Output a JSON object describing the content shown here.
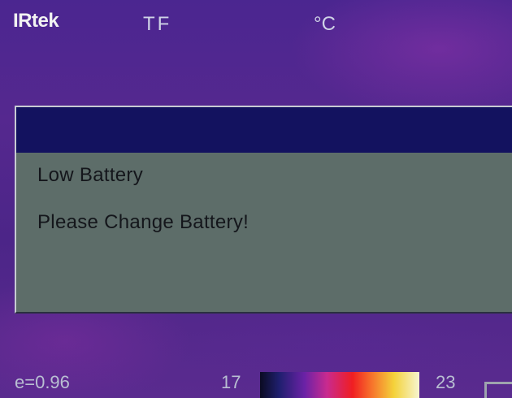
{
  "header": {
    "brand": "IRtek",
    "mode": "TF",
    "unit": "°C"
  },
  "dialog": {
    "title": "",
    "line1": "Low Battery",
    "line2": "Please Change Battery!"
  },
  "status": {
    "emissivity": "e=0.96",
    "temp_min": "17",
    "temp_max": "23"
  },
  "colors": {
    "background": "#4a2389",
    "dialog_body": "#5d6d69",
    "dialog_titlebar": "#13125f",
    "palette": [
      "#0b0b22",
      "#1f1f6e",
      "#6b22a6",
      "#c92a8f",
      "#f01e22",
      "#f7722b",
      "#f4d23a",
      "#f6f5d0"
    ]
  },
  "icons": {
    "battery": "battery-icon"
  }
}
